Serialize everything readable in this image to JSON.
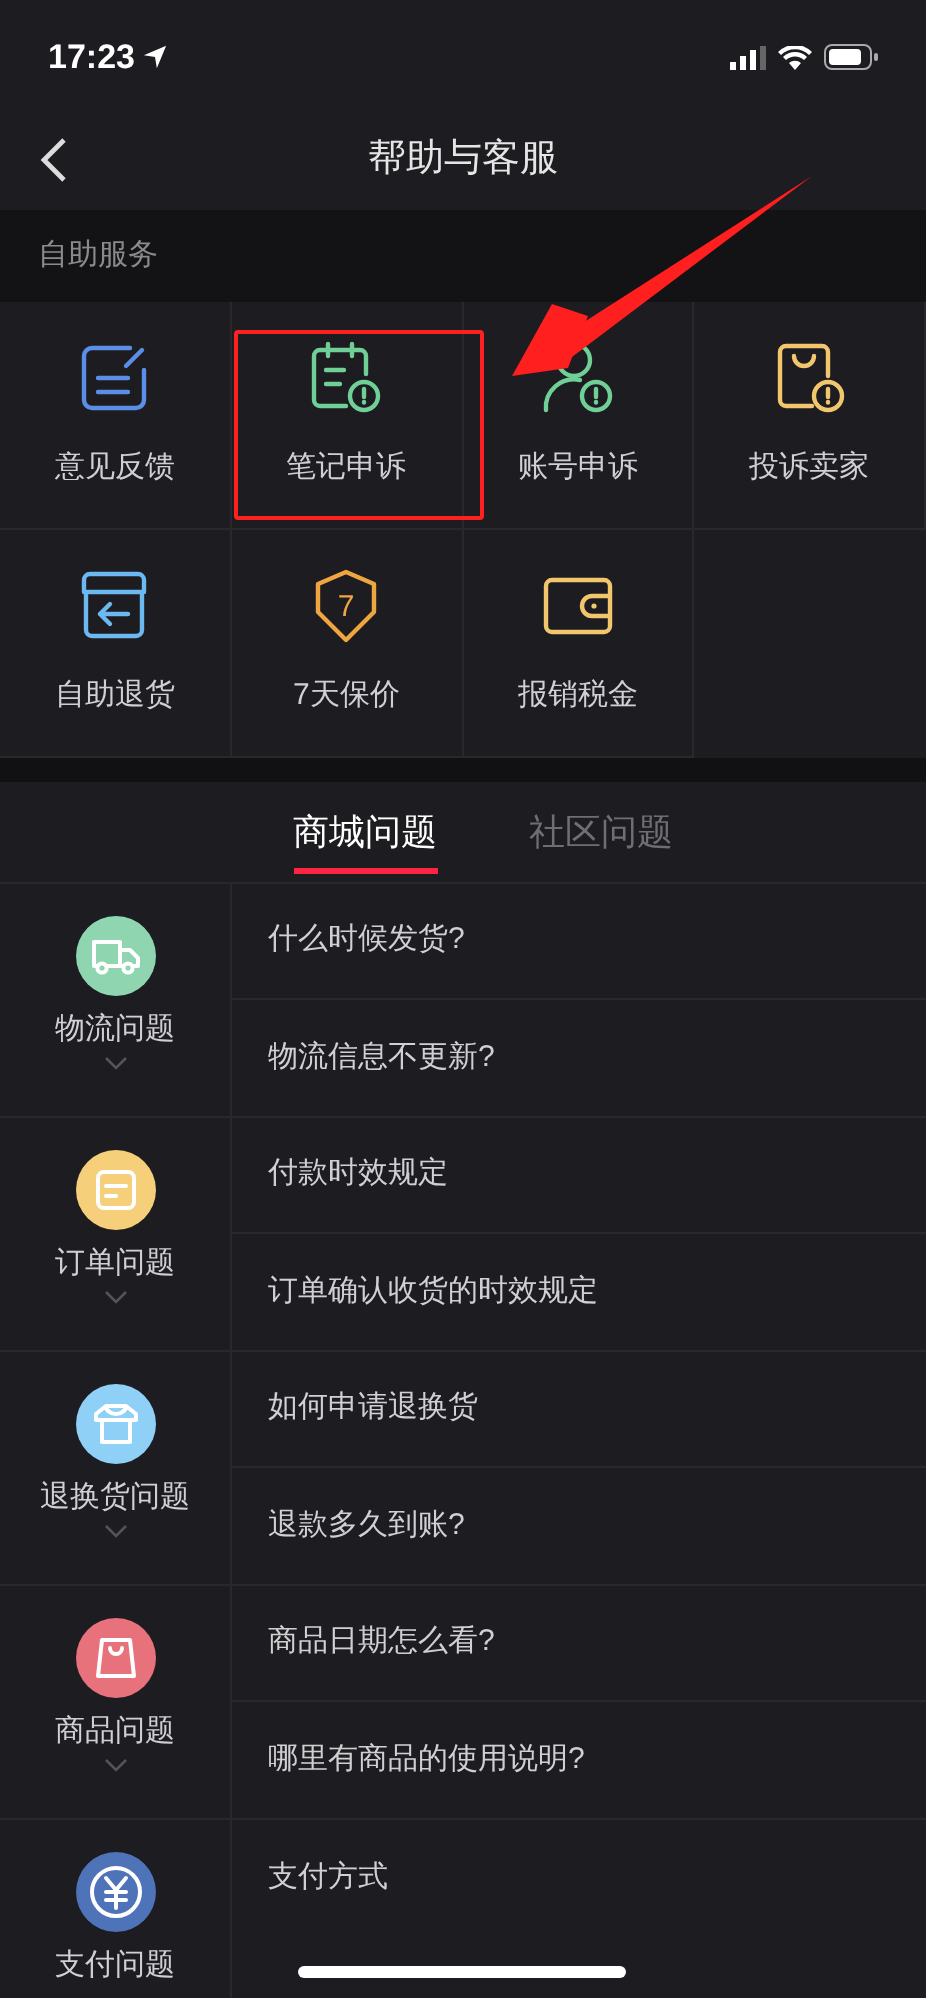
{
  "status_bar": {
    "time": "17:23"
  },
  "nav": {
    "title": "帮助与客服"
  },
  "self_service": {
    "heading": "自助服务",
    "items": [
      {
        "label": "意见反馈",
        "kind": "feedback",
        "color": "#5b8ee6",
        "highlighted": false
      },
      {
        "label": "笔记申诉",
        "kind": "note",
        "color": "#6fcf97",
        "highlighted": true
      },
      {
        "label": "账号申诉",
        "kind": "account",
        "color": "#6fcf97",
        "highlighted": false
      },
      {
        "label": "投诉卖家",
        "kind": "seller",
        "color": "#f2c66d",
        "highlighted": false
      },
      {
        "label": "自助退货",
        "kind": "return",
        "color": "#6cb8f0",
        "highlighted": false
      },
      {
        "label": "7天保价",
        "kind": "shield",
        "color": "#f0a640",
        "highlighted": false,
        "badge": "7"
      },
      {
        "label": "报销税金",
        "kind": "wallet",
        "color": "#f2c66d",
        "highlighted": false
      }
    ]
  },
  "tabs": [
    {
      "label": "商城问题",
      "selected": true
    },
    {
      "label": "社区问题",
      "selected": false
    }
  ],
  "categories": [
    {
      "label": "物流问题",
      "kind": "truck",
      "color": "#8fd6b0",
      "expanded": false,
      "questions": [
        "什么时候发货?",
        "物流信息不更新?"
      ]
    },
    {
      "label": "订单问题",
      "kind": "order",
      "color": "#f5cf7a",
      "expanded": false,
      "questions": [
        "付款时效规定",
        "订单确认收货的时效规定"
      ]
    },
    {
      "label": "退换货问题",
      "kind": "shirt",
      "color": "#8fd0f7",
      "expanded": false,
      "questions": [
        "如何申请退换货",
        "退款多久到账?"
      ]
    },
    {
      "label": "商品问题",
      "kind": "bag",
      "color": "#e8727c",
      "expanded": false,
      "questions": [
        "商品日期怎么看?",
        "哪里有商品的使用说明?"
      ]
    },
    {
      "label": "支付问题",
      "kind": "yen",
      "color": "#4f73b8",
      "questions": [
        "支付方式"
      ]
    }
  ]
}
